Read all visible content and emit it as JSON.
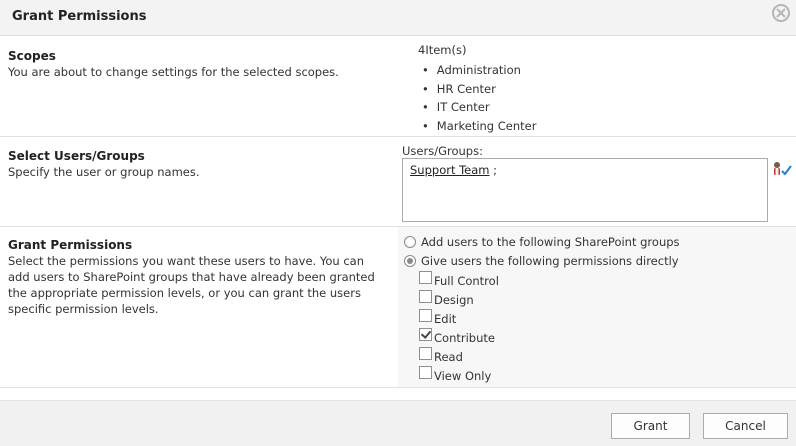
{
  "dialog": {
    "title": "Grant Permissions"
  },
  "scopes": {
    "title": "Scopes",
    "description": "You are about to change settings for the selected scopes.",
    "count_label": "4Item(s)",
    "items": [
      "Administration",
      "HR Center",
      "IT Center",
      "Marketing Center"
    ]
  },
  "users": {
    "title": "Select Users/Groups",
    "description": "Specify the user or group names.",
    "field_label": "Users/Groups:",
    "value_user": "Support Team",
    "value_separator": " ;"
  },
  "grant": {
    "title": "Grant Permissions",
    "description": "Select the permissions you want these users to have. You can add users to SharePoint groups that have already been granted the appropriate permission levels, or you can grant the users specific permission levels.",
    "option_groups": "Add users to the following SharePoint groups",
    "option_direct": "Give users the following permissions directly",
    "permissions": [
      {
        "label": "Full Control",
        "checked": false
      },
      {
        "label": "Design",
        "checked": false
      },
      {
        "label": "Edit",
        "checked": false
      },
      {
        "label": "Contribute",
        "checked": true
      },
      {
        "label": "Read",
        "checked": false
      },
      {
        "label": "View Only",
        "checked": false
      }
    ]
  },
  "footer": {
    "grant_label": "Grant",
    "cancel_label": "Cancel"
  },
  "colors": {
    "accent_check": "#2a7cd1"
  },
  "icons": {
    "close": "close-icon",
    "check_names": "check-names-icon"
  }
}
